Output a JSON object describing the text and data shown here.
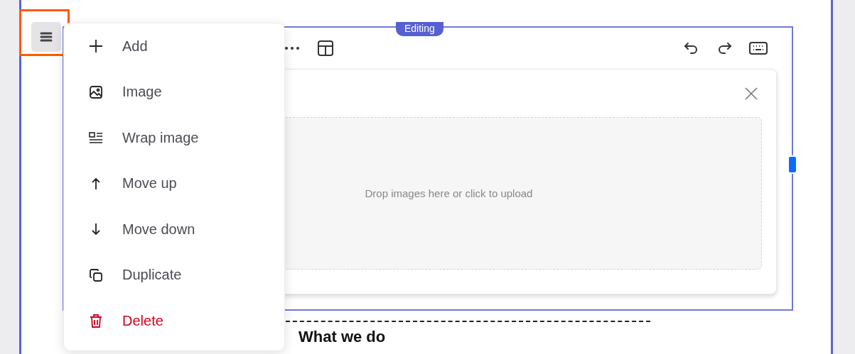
{
  "block_handle": {
    "focused": true
  },
  "badge": "Editing",
  "upload": {
    "hint": "Drop images here or click to upload"
  },
  "menu": [
    {
      "label": "Add",
      "kind": "add"
    },
    {
      "label": "Image",
      "kind": "image"
    },
    {
      "label": "Wrap image",
      "kind": "wrap"
    },
    {
      "label": "Move up",
      "kind": "up"
    },
    {
      "label": "Move down",
      "kind": "down"
    },
    {
      "label": "Duplicate",
      "kind": "duplicate"
    },
    {
      "label": "Delete",
      "kind": "delete"
    }
  ],
  "heading": "What we do"
}
